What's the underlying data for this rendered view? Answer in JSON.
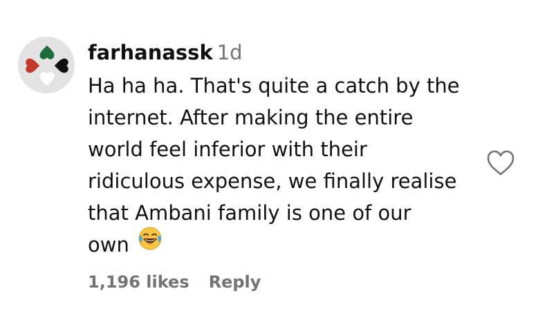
{
  "comment": {
    "username": "farhanassk",
    "time": "1d",
    "text_lines": [
      "Ha ha ha. That's quite a catch by the",
      "internet. After making the entire",
      "world feel inferior with their",
      "ridiculous expense, we finally realise",
      "that Ambani family is one of our",
      "own"
    ],
    "emoji": "face-with-tears-of-joy-icon",
    "likes": "1,196 likes",
    "reply_label": "Reply"
  },
  "avatar": {
    "background_color": "#e3e3e3",
    "hearts": [
      "#c0392b",
      "#1e6b3a",
      "#111111",
      "#ffffff"
    ]
  },
  "colors": {
    "text": "#111111",
    "meta_text": "#737373"
  }
}
